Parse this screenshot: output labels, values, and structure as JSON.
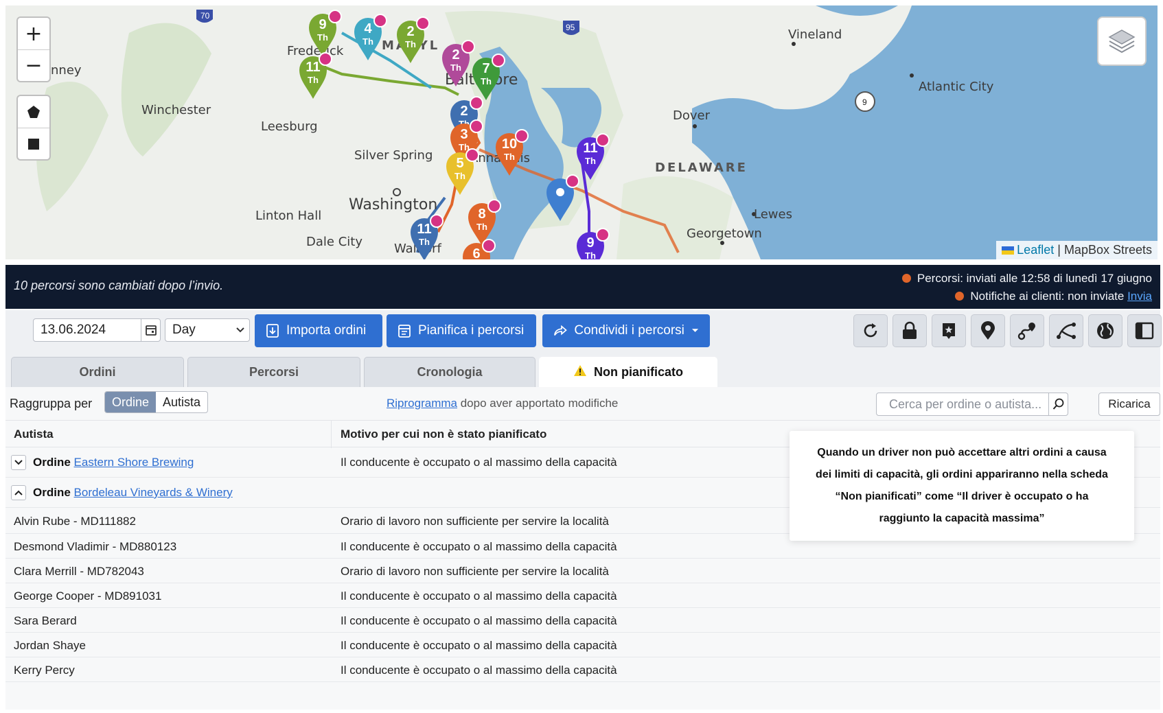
{
  "map": {
    "zoom_in": "+",
    "zoom_out": "−",
    "labels": {
      "nney": "nney",
      "frederick": "Frederick",
      "maryland": "MARYL",
      "baltimore": "Baltimore",
      "winchester": "Winchester",
      "leesburg": "Leesburg",
      "silver_spring": "Silver Spring",
      "annapolis": "Annapolis",
      "washington": "Washington",
      "linton_hall": "Linton Hall",
      "dale_city": "Dale City",
      "waldorf": "Waldorf",
      "vineland": "Vineland",
      "atlantic_city": "Atlantic City",
      "dover": "Dover",
      "delaware": "DELAWARE",
      "lewes": "Lewes",
      "georgetown": "Georgetown"
    },
    "highway_labels": {
      "i70": "70",
      "i95": "95",
      "r9": "9"
    },
    "attribution": {
      "leaflet": "Leaflet",
      "separator": "|",
      "provider": "MapBox Streets"
    },
    "markers": [
      {
        "num": "9",
        "th": "Th",
        "color": "#7aa832"
      },
      {
        "num": "11",
        "th": "Th",
        "color": "#7aa832"
      },
      {
        "num": "4",
        "th": "Th",
        "color": "#3fa8c4"
      },
      {
        "num": "2",
        "th": "Th",
        "color": "#7aa832"
      },
      {
        "num": "2",
        "th": "Th",
        "color": "#b04a9a"
      },
      {
        "num": "7",
        "th": "Th",
        "color": "#3f9a3a"
      },
      {
        "num": "2",
        "th": "Th",
        "color": "#3f6fb0"
      },
      {
        "num": "3",
        "th": "Th",
        "color": "#e0652a"
      },
      {
        "num": "10",
        "th": "Th",
        "color": "#e0652a"
      },
      {
        "num": "5",
        "th": "Th",
        "color": "#e8c02c"
      },
      {
        "num": "11",
        "th": "Th",
        "color": "#5a2bd6"
      },
      {
        "num": "8",
        "th": "Th",
        "color": "#e0652a"
      },
      {
        "num": "11",
        "th": "Th",
        "color": "#3f6fb0"
      },
      {
        "num": "9",
        "th": "Th",
        "color": "#5a2bd6"
      },
      {
        "num": "6",
        "th": "",
        "color": "#e0652a"
      },
      {
        "num": "",
        "th": "",
        "color": "#3f7fd0"
      }
    ]
  },
  "banner": {
    "message": "10 percorsi sono cambiati dopo l’invio.",
    "routes_status": "Percorsi: inviati alle 12:58 di lunedì 17 giugno",
    "notifications_status": "Notifiche ai clienti: non inviate",
    "send_link": "Invia",
    "dot_color": "#e0652a"
  },
  "toolbar": {
    "date_value": "13.06.2024",
    "period_value": "Day",
    "import_label": "Importa ordini",
    "plan_label": "Pianifica i percorsi",
    "share_label": "Condividi i percorsi"
  },
  "tabs": [
    {
      "label": "Ordini"
    },
    {
      "label": "Percorsi"
    },
    {
      "label": "Cronologia"
    },
    {
      "label": "Non pianificato"
    }
  ],
  "content": {
    "group_by_label": "Raggruppa per",
    "group_options": [
      "Ordine",
      "Autista"
    ],
    "reschedule_link": "Riprogramma",
    "reschedule_text": "dopo aver apportato modifiche",
    "search_placeholder": "Cerca per ordine o autista...",
    "reload_label": "Ricarica",
    "columns": [
      "Autista",
      "Motivo per cui non è stato pianificato"
    ],
    "groups": [
      {
        "prefix": "Ordine",
        "name": "Eastern Shore Brewing",
        "reason": "Il conducente è occupato o al massimo della capacità"
      },
      {
        "prefix": "Ordine",
        "name": "Bordeleau Vineyards & Winery",
        "reason": ""
      }
    ],
    "rows": [
      {
        "driver": "Alvin Rube - MD111882",
        "reason": "Orario di lavoro non sufficiente per servire la località"
      },
      {
        "driver": "Desmond Vladimir - MD880123",
        "reason": "Il conducente è occupato o al massimo della capacità"
      },
      {
        "driver": "Clara Merrill - MD782043",
        "reason": "Orario di lavoro non sufficiente per servire la località"
      },
      {
        "driver": "George Cooper - MD891031",
        "reason": "Il conducente è occupato o al massimo della capacità"
      },
      {
        "driver": "Sara Berard",
        "reason": "Il conducente è occupato o al massimo della capacità"
      },
      {
        "driver": "Jordan Shaye",
        "reason": "Il conducente è occupato o al massimo della capacità"
      },
      {
        "driver": "Kerry Percy",
        "reason": "Il conducente è occupato o al massimo della capacità"
      }
    ],
    "tooltip": "Quando un driver non può accettare altri ordini a causa dei limiti di capacità, gli ordini appariranno nella scheda “Non pianificati” come “Il driver è occupato o ha raggiunto la capacità massima”"
  },
  "colors": {
    "primary": "#2f6fd1",
    "banner_bg": "#0f1a2e",
    "water": "#7fb0d6",
    "land": "#eef0ec"
  }
}
